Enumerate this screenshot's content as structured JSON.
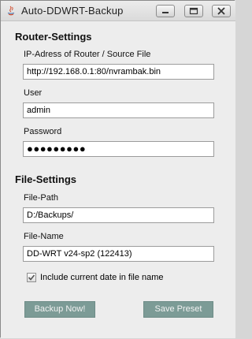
{
  "window": {
    "title": "Auto-DDWRT-Backup"
  },
  "router_settings": {
    "heading": "Router-Settings",
    "ip_label": "IP-Adress of Router / Source File",
    "ip_value": "http://192.168.0.1:80/nvrambak.bin",
    "user_label": "User",
    "user_value": "admin",
    "password_label": "Password",
    "password_value": "●●●●●●●●●"
  },
  "file_settings": {
    "heading": "File-Settings",
    "path_label": "File-Path",
    "path_value": "D:/Backups/",
    "name_label": "File-Name",
    "name_value": "DD-WRT v24-sp2 (122413)",
    "include_date_label": "Include current date in file name",
    "include_date_checked": true
  },
  "buttons": {
    "backup_label": "Backup Now!",
    "save_preset_label": "Save Preset"
  },
  "colors": {
    "button_bg": "#7c9b96",
    "button_text": "#f2f2f2"
  }
}
